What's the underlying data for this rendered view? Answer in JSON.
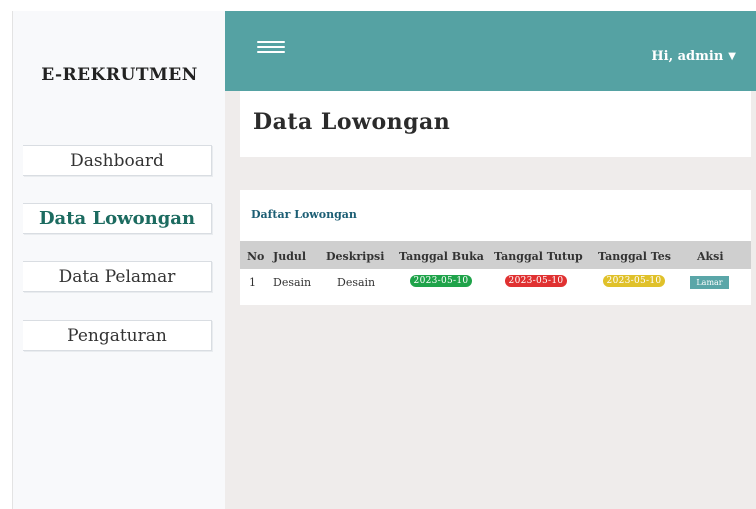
{
  "sidebar": {
    "brand": "E-REKRUTMEN",
    "items": [
      {
        "label": "Dashboard",
        "active": false
      },
      {
        "label": "Data Lowongan",
        "active": true
      },
      {
        "label": "Data Pelamar",
        "active": false
      },
      {
        "label": "Pengaturan",
        "active": false
      }
    ]
  },
  "header": {
    "user_greeting": "Hi, admin",
    "menu_icon": "hamburger-icon",
    "caret_icon": "caret-down-icon",
    "bar_color": "#55a2a3"
  },
  "page": {
    "title": "Data Lowongan"
  },
  "table": {
    "title": "Daftar Lowongan",
    "columns": [
      "No",
      "Judul",
      "Deskripsi",
      "Tanggal Buka",
      "Tanggal Tutup",
      "Tanggal Tes",
      "Aksi"
    ],
    "rows": [
      {
        "no": "1",
        "judul": "Desain",
        "deskripsi": "Desain",
        "tanggal_buka": "2023-05-10",
        "tanggal_tutup": "2023-05-10",
        "tanggal_tes": "2023-05-10",
        "aksi": "Lamar"
      }
    ]
  },
  "colors": {
    "accent": "#55a2a3",
    "badge_open": "#1fa34a",
    "badge_close": "#e03131",
    "badge_test": "#e0c12a"
  }
}
